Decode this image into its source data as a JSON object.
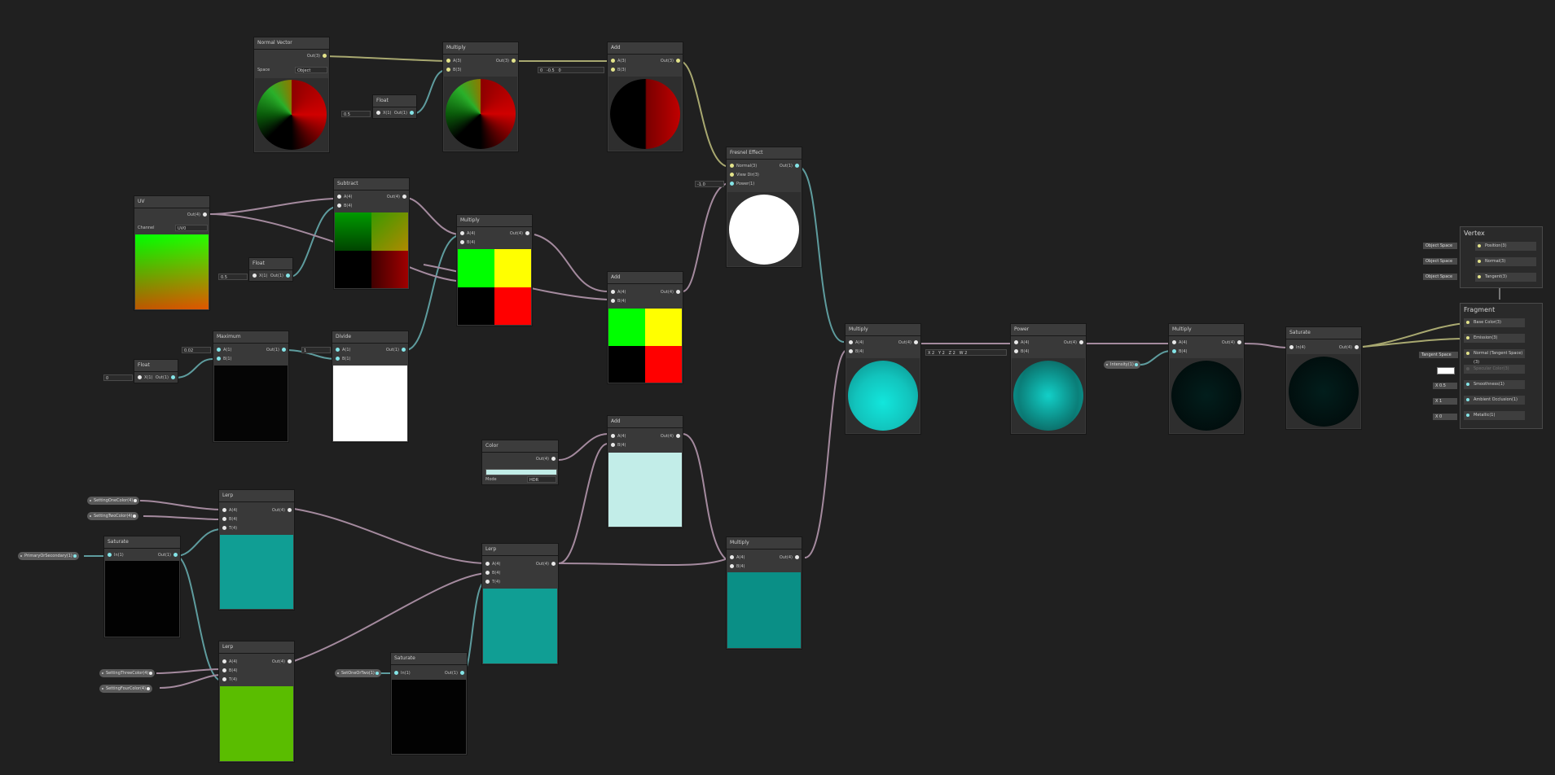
{
  "nodes": {
    "normal_vector": {
      "title": "Normal Vector",
      "out": "Out(3)",
      "space_label": "Space",
      "space_value": "Object"
    },
    "float_top": {
      "title": "Float",
      "x": "0.5",
      "in": "X(1)",
      "out": "Out(1)"
    },
    "multiply_top": {
      "title": "Multiply",
      "a": "A(3)",
      "b": "B(3)",
      "out": "Out(3)"
    },
    "add_top": {
      "title": "Add",
      "a": "A(3)",
      "b": "B(3)",
      "out": "Out(3)",
      "fx": "0",
      "fy": "-0.5",
      "fz": "0"
    },
    "fresnel": {
      "title": "Fresnel Effect",
      "normal": "Normal(3)",
      "view": "View Dir(3)",
      "power": "Power(1)",
      "out": "Out(1)",
      "power_value": "-1.0"
    },
    "uv": {
      "title": "UV",
      "out": "Out(4)",
      "channel_label": "Channel",
      "channel_value": "UV0"
    },
    "float_mid": {
      "title": "Float",
      "x": "0.5",
      "in": "X(1)",
      "out": "Out(1)"
    },
    "subtract": {
      "title": "Subtract",
      "a": "A(4)",
      "b": "B(4)",
      "out": "Out(4)"
    },
    "multiply_mid": {
      "title": "Multiply",
      "a": "A(4)",
      "b": "B(4)",
      "out": "Out(4)"
    },
    "add_mid": {
      "title": "Add",
      "a": "A(4)",
      "b": "B(4)",
      "out": "Out(4)"
    },
    "float_low": {
      "title": "Float",
      "x": "0",
      "in": "X(1)",
      "out": "Out(1)"
    },
    "maximum": {
      "title": "Maximum",
      "a": "A(1)",
      "b": "B(1)",
      "out": "Out(1)",
      "a_value": "0.02"
    },
    "divide": {
      "title": "Divide",
      "a": "A(1)",
      "b": "B(1)",
      "out": "Out(1)",
      "a_value": "1"
    },
    "color": {
      "title": "Color",
      "out": "Out(4)",
      "mode_label": "Mode",
      "mode_value": "HDR"
    },
    "add_low": {
      "title": "Add",
      "a": "A(4)",
      "b": "B(4)",
      "out": "Out(4)"
    },
    "lerp_a": {
      "title": "Lerp",
      "a": "A(4)",
      "b": "B(4)",
      "t": "T(4)",
      "out": "Out(4)"
    },
    "saturate_left": {
      "title": "Saturate",
      "in": "In(1)",
      "out": "Out(1)"
    },
    "lerp_b": {
      "title": "Lerp",
      "a": "A(4)",
      "b": "B(4)",
      "t": "T(4)",
      "out": "Out(4)"
    },
    "lerp_c": {
      "title": "Lerp",
      "a": "A(4)",
      "b": "B(4)",
      "t": "T(4)",
      "out": "Out(4)"
    },
    "saturate_bottom": {
      "title": "Saturate",
      "in": "In(1)",
      "out": "Out(1)"
    },
    "multiply_low": {
      "title": "Multiply",
      "a": "A(4)",
      "b": "B(4)",
      "out": "Out(4)"
    },
    "multiply_center": {
      "title": "Multiply",
      "a": "A(4)",
      "b": "B(4)",
      "out": "Out(4)"
    },
    "power": {
      "title": "Power",
      "a": "A(4)",
      "b": "B(4)",
      "out": "Out(4)",
      "bx": "2",
      "by": "2",
      "bz": "2",
      "bw": "2"
    },
    "multiply_right": {
      "title": "Multiply",
      "a": "A(4)",
      "b": "B(4)",
      "out": "Out(4)"
    },
    "saturate_right": {
      "title": "Saturate",
      "in": "In(4)",
      "out": "Out(4)"
    }
  },
  "properties": {
    "setting_one": "SettingOneColor(4)",
    "setting_two": "SettingTwoColor(4)",
    "primary_secondary": "PrimaryOrSecondary(1)",
    "setting_three": "SettingThreeColor(4)",
    "setting_four": "SettingFourColor(4)",
    "set_one_or_two": "SetOneOrTwo(1)",
    "intensity": "Intensity(1)"
  },
  "master": {
    "vertex_title": "Vertex",
    "vertex_slots": [
      {
        "space": "Object Space",
        "label": "Position(3)"
      },
      {
        "space": "Object Space",
        "label": "Normal(3)"
      },
      {
        "space": "Object Space",
        "label": "Tangent(3)"
      }
    ],
    "fragment_title": "Fragment",
    "fragment_slots": [
      {
        "label": "Base Color(3)"
      },
      {
        "label": "Emission(3)"
      },
      {
        "space": "Tangent Space",
        "label": "Normal (Tangent Space)(3)"
      },
      {
        "label": "Specular Color(3)"
      },
      {
        "field": "X  0.5",
        "label": "Smoothness(1)"
      },
      {
        "field": "X  1",
        "label": "Ambient Occlusion(1)"
      },
      {
        "field": "X  0",
        "label": "Metallic(1)"
      }
    ]
  },
  "colors": {
    "wire_pink": "#a48a9e",
    "wire_yellow": "#a8a870",
    "wire_cyan": "#5e9c9e",
    "teal": "#109e94",
    "cyan_sphere": "#1ad9d0",
    "light_cyan": "#c2ede8",
    "green": "#5abd00"
  }
}
